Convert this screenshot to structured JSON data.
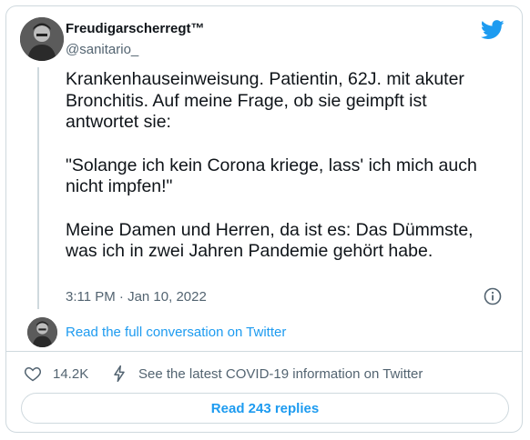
{
  "author": {
    "name": "Freudigarscherregt™",
    "handle": "@sanitario_"
  },
  "tweet": {
    "paragraph1": "Krankenhauseinweisung. Patientin, 62J. mit akuter Bronchitis. Auf meine Frage, ob sie geimpft ist antwortet sie:",
    "paragraph2": "\"Solange ich kein Corona kriege, lass' ich mich auch nicht impfen!\"",
    "paragraph3": "Meine Damen und Herren, da ist es: Das Dümmste, was ich in zwei Jahren Pandemie gehört habe.",
    "timestamp": "3:11 PM · Jan 10, 2022"
  },
  "conversation_link": "Read the full conversation on Twitter",
  "actions": {
    "like_count": "14.2K",
    "covid_info": "See the latest COVID-19 information on Twitter"
  },
  "replies_button": "Read 243 replies",
  "icons": {
    "brand": "twitter-bird-icon",
    "info": "info-icon",
    "like": "heart-icon",
    "covid": "lightning-bolt-icon"
  },
  "colors": {
    "link_blue": "#1d9bf0",
    "text_primary": "#0f1419",
    "text_secondary": "#536471",
    "border": "#cfd9de"
  }
}
